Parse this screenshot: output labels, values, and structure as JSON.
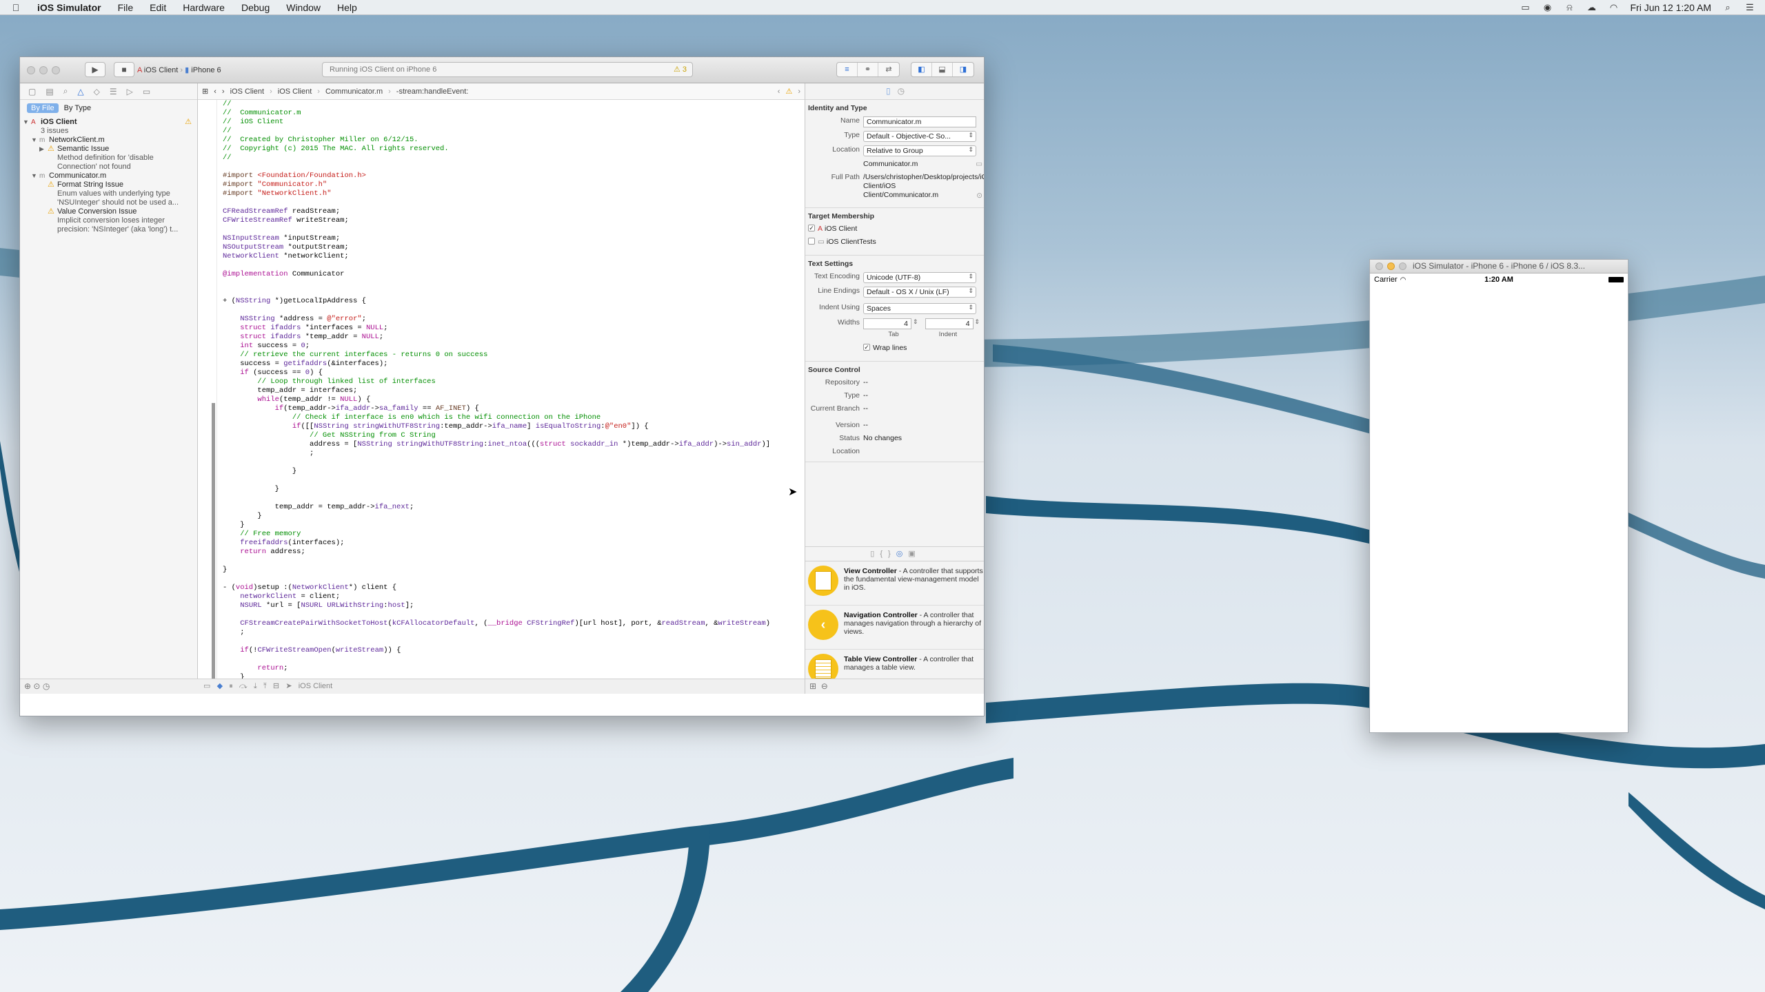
{
  "menubar": {
    "app": "iOS Simulator",
    "items": [
      "File",
      "Edit",
      "Hardware",
      "Debug",
      "Window",
      "Help"
    ],
    "clock": "Fri Jun 12  1:20 AM"
  },
  "toolbar": {
    "scheme_target": "iOS Client",
    "scheme_device": "iPhone 6",
    "activity": "Running iOS Client on iPhone 6",
    "warnings": "⚠ 3"
  },
  "navigator": {
    "seg_byfile": "By File",
    "seg_bytype": "By Type",
    "project": "iOS Client",
    "issues_count": "3 issues",
    "file1": "NetworkClient.m",
    "issue1_title": "Semantic Issue",
    "issue1_text": "Method definition for 'disable Connection' not found",
    "file2": "Communicator.m",
    "issue2_title": "Format String Issue",
    "issue2_text": "Enum values with underlying type 'NSUInteger' should not be used a...",
    "issue3_title": "Value Conversion Issue",
    "issue3_text": "Implicit conversion loses integer precision: 'NSInteger' (aka 'long') t..."
  },
  "jumpbar": {
    "p1": "iOS Client",
    "p2": "iOS Client",
    "p3": "Communicator.m",
    "p4": "-stream:handleEvent:"
  },
  "editor_bottom": {
    "target": "iOS Client"
  },
  "inspector": {
    "identity_header": "Identity and Type",
    "name_label": "Name",
    "name_value": "Communicator.m",
    "type_label": "Type",
    "type_value": "Default - Objective-C So...",
    "location_label": "Location",
    "location_value": "Relative to Group",
    "location_file": "Communicator.m",
    "fullpath_label": "Full Path",
    "fullpath_value": "/Users/christopher/Desktop/projects/iOS Client/iOS Client/Communicator.m",
    "target_header": "Target Membership",
    "target1": "iOS Client",
    "target2": "iOS ClientTests",
    "text_header": "Text Settings",
    "encoding_label": "Text Encoding",
    "encoding_value": "Unicode (UTF-8)",
    "endings_label": "Line Endings",
    "endings_value": "Default - OS X / Unix (LF)",
    "indent_label": "Indent Using",
    "indent_value": "Spaces",
    "widths_label": "Widths",
    "tab_value": "4",
    "indent_num": "4",
    "tab_caption": "Tab",
    "indent_caption": "Indent",
    "wrap_label": "Wrap lines",
    "sc_header": "Source Control",
    "repo_label": "Repository",
    "repo_value": "--",
    "sctype_label": "Type",
    "sctype_value": "--",
    "branch_label": "Current Branch",
    "branch_value": "--",
    "version_label": "Version",
    "version_value": "--",
    "status_label": "Status",
    "status_value": "No changes",
    "sclocation_label": "Location"
  },
  "library": [
    {
      "title": "View Controller",
      "desc": " - A controller that supports the fundamental view-management model in iOS."
    },
    {
      "title": "Navigation Controller",
      "desc": " - A controller that manages navigation through a hierarchy of views."
    },
    {
      "title": "Table View Controller",
      "desc": " - A controller that manages a table view."
    }
  ],
  "simulator": {
    "title": "iOS Simulator - iPhone 6 - iPhone 6 / iOS 8.3...",
    "carrier": "Carrier",
    "time": "1:20 AM"
  },
  "colors": {
    "comment": "#008e00",
    "keyword": "#aa0d91",
    "string": "#c41a16",
    "selection": "#7fb0ea",
    "library_icon": "#f6c21a"
  }
}
